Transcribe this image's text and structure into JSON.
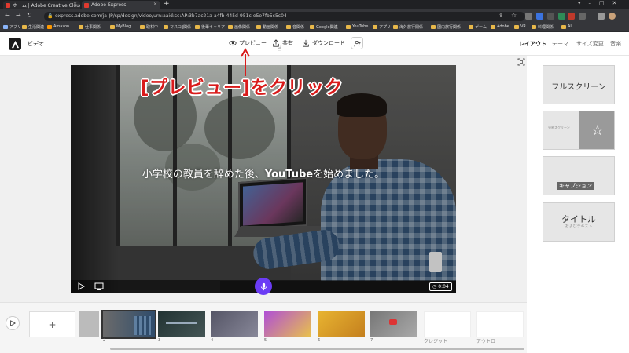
{
  "browser": {
    "tabs": [
      {
        "title": "ホーム | Adobe Creative Cloud",
        "active": false,
        "favicon_color": "#e03a2f"
      },
      {
        "title": "Adobe Express",
        "active": true,
        "favicon_color": "#e03a2f"
      }
    ],
    "new_tab": "+",
    "url": "express.adobe.com/ja-JP/sp/design/video/urn:aaid:sc:AP:3b7ac21a-a4fb-445d-951c-e5e7fb5c5c04",
    "bookmarks": [
      "アプリ",
      "生活関連",
      "Amazon",
      "仕事関係",
      "MyBlog",
      "取材中",
      "マスコ]関係",
      "後輩キャリア",
      "画像関係",
      "動画関係",
      "音関係",
      "Google関連",
      "YouTube",
      "アプリ",
      "海外旅行関係",
      "国内旅行関係",
      "ゲーム",
      "Adobe",
      "VR",
      "料理関係",
      "AI"
    ]
  },
  "header": {
    "project_title": "ビデオ",
    "preview_label": "プレビュー",
    "share_label": "共有",
    "download_label": "ダウンロード",
    "right_tabs": [
      "レイアウト",
      "テーマ",
      "サイズ変更",
      "音楽"
    ]
  },
  "video": {
    "caption_pre": "小学校の教員を辞めた後、",
    "caption_bold": "YouTube",
    "caption_post": "を始めました。",
    "timer": "0:04"
  },
  "callout": {
    "text": "[プレビュー]をクリック",
    "color": "#d91b1b"
  },
  "layouts": {
    "fullscreen": "フルスクリーン",
    "split_small": "分割スクリーン",
    "caption": "キャプション",
    "title": "タイトル",
    "title_sub": "およびテキスト"
  },
  "timeline": {
    "add_label": "+",
    "scene_numbers": [
      "2",
      "3",
      "4",
      "5",
      "6",
      "7"
    ],
    "credit_label": "クレジット",
    "outro_label": "アウトロ"
  },
  "colors": {
    "accent": "#6b3cf5",
    "browser_bg": "#202124"
  }
}
